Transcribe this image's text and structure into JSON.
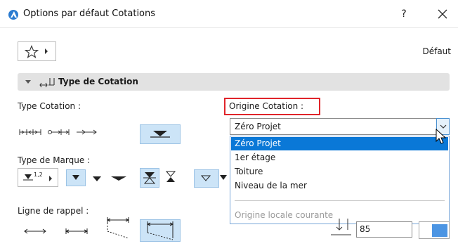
{
  "window": {
    "title": "Options par défaut Cotations",
    "help_label": "?",
    "default_label": "Défaut"
  },
  "panel": {
    "title": "Type de Cotation"
  },
  "sections": {
    "type_cotation": "Type Cotation :",
    "type_marque": "Type de Marque :",
    "ligne_rappel": "Ligne de rappel :"
  },
  "marque": {
    "size_glyph": "1,2"
  },
  "origin": {
    "label": "Origine Cotation :",
    "selected": "Zéro Projet",
    "options": [
      "Zéro Projet",
      "1er étage",
      "Toiture",
      "Niveau de la mer"
    ],
    "highlighted_index": 0,
    "disabled_option": "Origine locale courante"
  },
  "bottom": {
    "value": "85"
  },
  "colors": {
    "accent": "#0a78d7",
    "highlight_box": "#e0242a",
    "selected_tool_bg": "#cce4f7",
    "panel_header_bg": "#e2e2e2",
    "swatch": "#4c95e3"
  }
}
